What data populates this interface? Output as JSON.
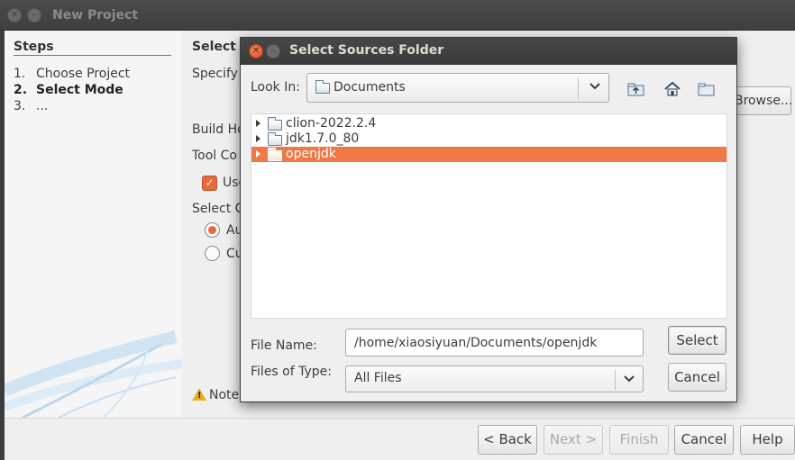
{
  "background_window": {
    "title": "New Project",
    "steps": {
      "heading": "Steps",
      "items": [
        {
          "num": "1.",
          "label": "Choose Project"
        },
        {
          "num": "2.",
          "label": "Select Mode"
        },
        {
          "num": "3.",
          "label": "..."
        }
      ]
    },
    "content": {
      "heading": "Select M",
      "specify_label": "Specify",
      "browse_button": "Browse...",
      "build_host_label": "Build Ho",
      "tool_collection_label": "Tool Co",
      "use_checkbox_label": "Use",
      "select_config_label": "Select C",
      "radio_auto_label": "Au",
      "radio_custom_label": "Cu",
      "note_label": "Note"
    },
    "buttons": {
      "back": "< Back",
      "next": "Next >",
      "finish": "Finish",
      "cancel": "Cancel",
      "help": "Help"
    }
  },
  "dialog": {
    "title": "Select Sources Folder",
    "look_in_label": "Look In:",
    "look_in_value": "Documents",
    "toolbar_icons": [
      "up-folder-icon",
      "home-icon",
      "new-folder-icon"
    ],
    "files": [
      {
        "name": "clion-2022.2.4",
        "selected": false
      },
      {
        "name": "jdk1.7.0_80",
        "selected": false
      },
      {
        "name": "openjdk",
        "selected": true
      }
    ],
    "file_name_label": "File Name:",
    "file_name_value": "/home/xiaosiyuan/Documents/openjdk",
    "files_of_type_label": "Files of Type:",
    "files_of_type_value": "All Files",
    "select_button": "Select",
    "cancel_button": "Cancel"
  },
  "colors": {
    "accent": "#f07746",
    "titlebar": "#3f3f3f",
    "close_button": "#e0491f",
    "warning": "#e8b21c"
  }
}
